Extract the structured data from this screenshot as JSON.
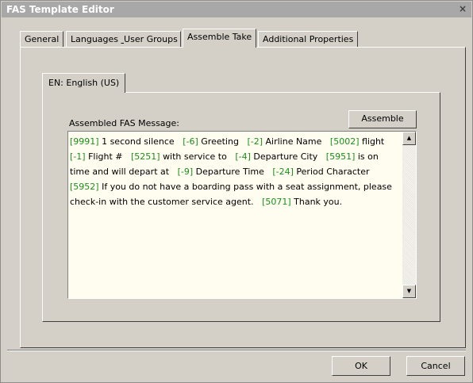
{
  "window": {
    "title": "FAS Template Editor",
    "close_glyph": "×"
  },
  "tabs": [
    {
      "label": "General"
    },
    {
      "label": "Languages"
    },
    {
      "label": "User Groups"
    },
    {
      "label": "Assemble Take"
    },
    {
      "label": "Additional Properties"
    }
  ],
  "active_tab": "Assemble Take",
  "language_tab": {
    "label": "EN: English (US)"
  },
  "message": {
    "label": "Assembled FAS Message:",
    "assemble_label": "Assemble",
    "segments": [
      {
        "code": "[9991]",
        "text": "1 second silence"
      },
      {
        "code": "[-6]",
        "text": "Greeting"
      },
      {
        "code": "[-2]",
        "text": "Airline Name"
      },
      {
        "code": "[5002]",
        "text": "flight"
      },
      {
        "code": "[-1]",
        "text": "Flight #"
      },
      {
        "code": "[5251]",
        "text": "with service to"
      },
      {
        "code": "[-4]",
        "text": "Departure City"
      },
      {
        "code": "[5951]",
        "text": "is on time and will depart at"
      },
      {
        "code": "[-9]",
        "text": "Departure Time"
      },
      {
        "code": "[-24]",
        "text": "Period Character"
      },
      {
        "code": "[5952]",
        "text": "If you do not have a boarding pass with a seat assignment, please check-in with the customer service agent."
      },
      {
        "code": "[5071]",
        "text": "Thank you."
      }
    ]
  },
  "footer": {
    "ok_label": "OK",
    "cancel_label": "Cancel"
  },
  "icons": {
    "scroll_up": "scroll-up-icon",
    "scroll_down": "scroll-down-icon",
    "close": "close-icon"
  }
}
